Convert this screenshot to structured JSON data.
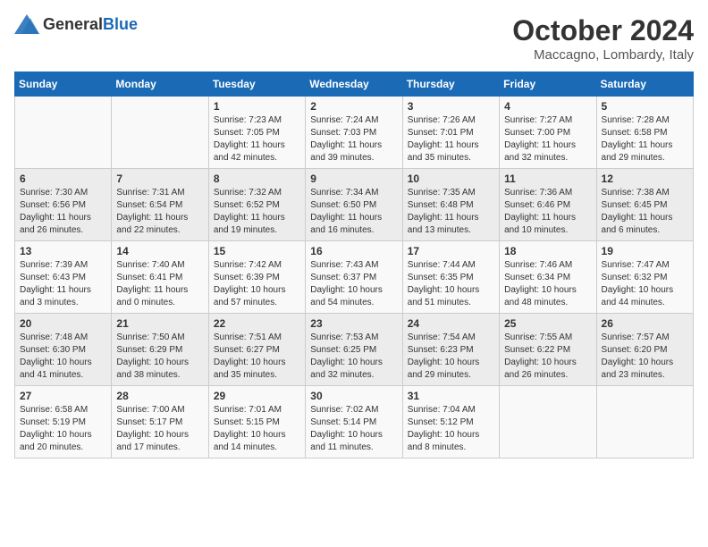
{
  "header": {
    "logo_general": "General",
    "logo_blue": "Blue",
    "month": "October 2024",
    "location": "Maccagno, Lombardy, Italy"
  },
  "days_of_week": [
    "Sunday",
    "Monday",
    "Tuesday",
    "Wednesday",
    "Thursday",
    "Friday",
    "Saturday"
  ],
  "weeks": [
    [
      {
        "day": "",
        "info": ""
      },
      {
        "day": "",
        "info": ""
      },
      {
        "day": "1",
        "info": "Sunrise: 7:23 AM\nSunset: 7:05 PM\nDaylight: 11 hours and 42 minutes."
      },
      {
        "day": "2",
        "info": "Sunrise: 7:24 AM\nSunset: 7:03 PM\nDaylight: 11 hours and 39 minutes."
      },
      {
        "day": "3",
        "info": "Sunrise: 7:26 AM\nSunset: 7:01 PM\nDaylight: 11 hours and 35 minutes."
      },
      {
        "day": "4",
        "info": "Sunrise: 7:27 AM\nSunset: 7:00 PM\nDaylight: 11 hours and 32 minutes."
      },
      {
        "day": "5",
        "info": "Sunrise: 7:28 AM\nSunset: 6:58 PM\nDaylight: 11 hours and 29 minutes."
      }
    ],
    [
      {
        "day": "6",
        "info": "Sunrise: 7:30 AM\nSunset: 6:56 PM\nDaylight: 11 hours and 26 minutes."
      },
      {
        "day": "7",
        "info": "Sunrise: 7:31 AM\nSunset: 6:54 PM\nDaylight: 11 hours and 22 minutes."
      },
      {
        "day": "8",
        "info": "Sunrise: 7:32 AM\nSunset: 6:52 PM\nDaylight: 11 hours and 19 minutes."
      },
      {
        "day": "9",
        "info": "Sunrise: 7:34 AM\nSunset: 6:50 PM\nDaylight: 11 hours and 16 minutes."
      },
      {
        "day": "10",
        "info": "Sunrise: 7:35 AM\nSunset: 6:48 PM\nDaylight: 11 hours and 13 minutes."
      },
      {
        "day": "11",
        "info": "Sunrise: 7:36 AM\nSunset: 6:46 PM\nDaylight: 11 hours and 10 minutes."
      },
      {
        "day": "12",
        "info": "Sunrise: 7:38 AM\nSunset: 6:45 PM\nDaylight: 11 hours and 6 minutes."
      }
    ],
    [
      {
        "day": "13",
        "info": "Sunrise: 7:39 AM\nSunset: 6:43 PM\nDaylight: 11 hours and 3 minutes."
      },
      {
        "day": "14",
        "info": "Sunrise: 7:40 AM\nSunset: 6:41 PM\nDaylight: 11 hours and 0 minutes."
      },
      {
        "day": "15",
        "info": "Sunrise: 7:42 AM\nSunset: 6:39 PM\nDaylight: 10 hours and 57 minutes."
      },
      {
        "day": "16",
        "info": "Sunrise: 7:43 AM\nSunset: 6:37 PM\nDaylight: 10 hours and 54 minutes."
      },
      {
        "day": "17",
        "info": "Sunrise: 7:44 AM\nSunset: 6:35 PM\nDaylight: 10 hours and 51 minutes."
      },
      {
        "day": "18",
        "info": "Sunrise: 7:46 AM\nSunset: 6:34 PM\nDaylight: 10 hours and 48 minutes."
      },
      {
        "day": "19",
        "info": "Sunrise: 7:47 AM\nSunset: 6:32 PM\nDaylight: 10 hours and 44 minutes."
      }
    ],
    [
      {
        "day": "20",
        "info": "Sunrise: 7:48 AM\nSunset: 6:30 PM\nDaylight: 10 hours and 41 minutes."
      },
      {
        "day": "21",
        "info": "Sunrise: 7:50 AM\nSunset: 6:29 PM\nDaylight: 10 hours and 38 minutes."
      },
      {
        "day": "22",
        "info": "Sunrise: 7:51 AM\nSunset: 6:27 PM\nDaylight: 10 hours and 35 minutes."
      },
      {
        "day": "23",
        "info": "Sunrise: 7:53 AM\nSunset: 6:25 PM\nDaylight: 10 hours and 32 minutes."
      },
      {
        "day": "24",
        "info": "Sunrise: 7:54 AM\nSunset: 6:23 PM\nDaylight: 10 hours and 29 minutes."
      },
      {
        "day": "25",
        "info": "Sunrise: 7:55 AM\nSunset: 6:22 PM\nDaylight: 10 hours and 26 minutes."
      },
      {
        "day": "26",
        "info": "Sunrise: 7:57 AM\nSunset: 6:20 PM\nDaylight: 10 hours and 23 minutes."
      }
    ],
    [
      {
        "day": "27",
        "info": "Sunrise: 6:58 AM\nSunset: 5:19 PM\nDaylight: 10 hours and 20 minutes."
      },
      {
        "day": "28",
        "info": "Sunrise: 7:00 AM\nSunset: 5:17 PM\nDaylight: 10 hours and 17 minutes."
      },
      {
        "day": "29",
        "info": "Sunrise: 7:01 AM\nSunset: 5:15 PM\nDaylight: 10 hours and 14 minutes."
      },
      {
        "day": "30",
        "info": "Sunrise: 7:02 AM\nSunset: 5:14 PM\nDaylight: 10 hours and 11 minutes."
      },
      {
        "day": "31",
        "info": "Sunrise: 7:04 AM\nSunset: 5:12 PM\nDaylight: 10 hours and 8 minutes."
      },
      {
        "day": "",
        "info": ""
      },
      {
        "day": "",
        "info": ""
      }
    ]
  ]
}
